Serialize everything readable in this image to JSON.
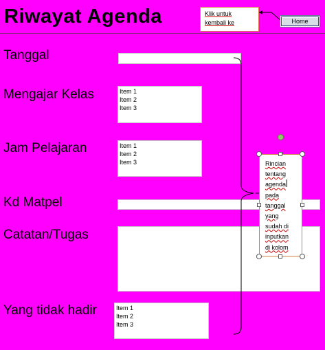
{
  "header": {
    "title": "Riwayat Agenda",
    "callout_text": "Klik untuk kembali ke",
    "home_label": "Home"
  },
  "form": {
    "tanggal_label": "Tanggal",
    "mengajar_kelas_label": "Mengajar Kelas",
    "jam_pelajaran_label": "Jam Pelajaran",
    "kd_matpel_label": "Kd Matpel",
    "catatan_tugas_label": "Catatan/Tugas",
    "yang_tidak_hadir_label": "Yang tidak hadir",
    "list_items": [
      "Item 1",
      "Item 2",
      "Item 3"
    ]
  },
  "annotation": {
    "lines": [
      "Rincian",
      "tentang",
      "agenda",
      "pada",
      "tanggal",
      "yang",
      "sudah di",
      "inputkan",
      "di kolom"
    ]
  },
  "colors": {
    "background": "#ff00ff",
    "callout_border": "#e0784a",
    "rotate_handle": "#92c66a"
  }
}
